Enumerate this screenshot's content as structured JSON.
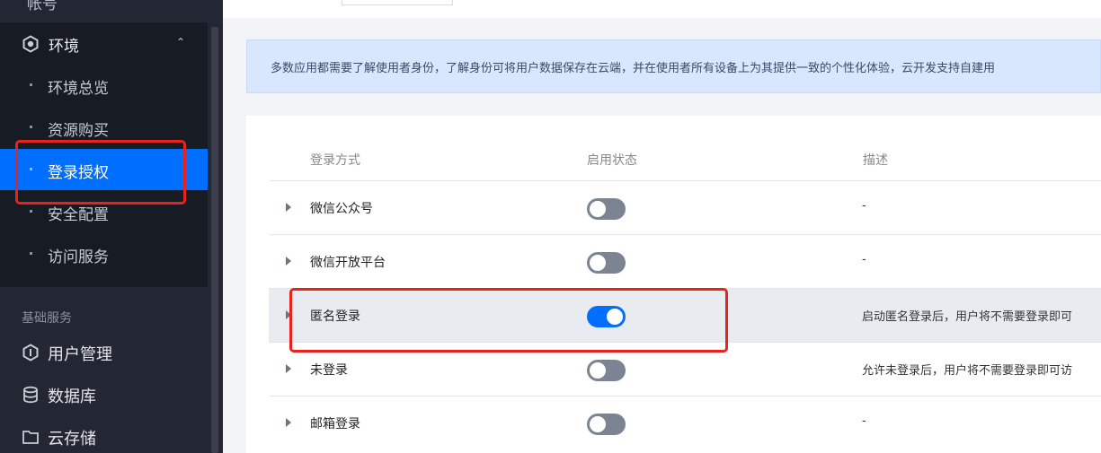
{
  "sidebar": {
    "top_partial_label": "帐号",
    "env_group": {
      "label": "环境",
      "icon": "hexagon-icon",
      "expanded": true
    },
    "env_items": [
      {
        "label": "环境总览",
        "active": false
      },
      {
        "label": "资源购买",
        "active": false
      },
      {
        "label": "登录授权",
        "active": true
      },
      {
        "label": "安全配置",
        "active": false
      },
      {
        "label": "访问服务",
        "active": false
      }
    ],
    "section_title": "基础服务",
    "main_items": [
      {
        "label": "用户管理",
        "icon": "user-manage-icon"
      },
      {
        "label": "数据库",
        "icon": "database-icon"
      },
      {
        "label": "云存储",
        "icon": "folder-icon"
      }
    ]
  },
  "info_bar": {
    "text": "多数应用都需要了解使用者身份，了解身份可将用户数据保存在云端，并在使用者所有设备上为其提供一致的个性化体验，云开发支持自建用"
  },
  "table": {
    "headers": [
      "登录方式",
      "启用状态",
      "描述"
    ],
    "rows": [
      {
        "name": "微信公众号",
        "enabled": false,
        "desc": "-"
      },
      {
        "name": "微信开放平台",
        "enabled": false,
        "desc": "-"
      },
      {
        "name": "匿名登录",
        "enabled": true,
        "desc": "启动匿名登录后，用户将不需要登录即可"
      },
      {
        "name": "未登录",
        "enabled": false,
        "desc": "允许未登录后，用户将不需要登录即可访"
      },
      {
        "name": "邮箱登录",
        "enabled": false,
        "desc": "-"
      }
    ]
  },
  "colors": {
    "accent": "#006eff",
    "sidebar_bg": "#232733",
    "highlight_box": "#e8221c"
  }
}
